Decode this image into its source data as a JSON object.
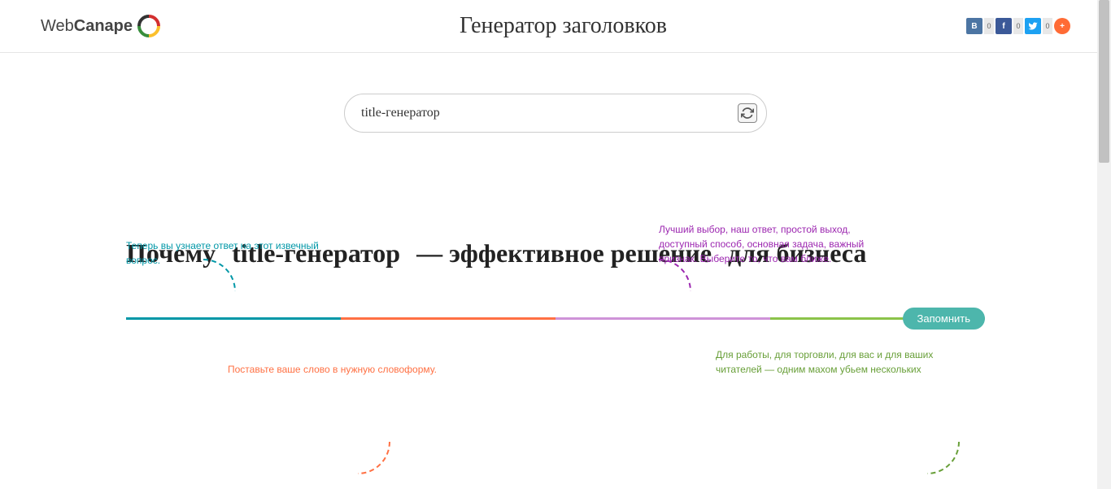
{
  "header": {
    "logo_web": "Web",
    "logo_canape": "Canape",
    "title": "Генератор заголовков"
  },
  "social": {
    "vk_count": "0",
    "fb_count": "0",
    "tw_count": "0"
  },
  "search": {
    "value": "title-генератор"
  },
  "hints": {
    "teal": "Теперь вы узнаете ответ на этот извечный вопрос.",
    "purple": "Лучший выбор, наш ответ, простой выход, доступный способ, основная задача, важный признак. Выберите то, что вам ближе.",
    "orange": "Поставьте ваше слово в нужную словоформу.",
    "green": "Для работы, для торговли, для вас и для ваших читателей — одним махом убьем нескольких"
  },
  "headline": {
    "part1": "Почему",
    "part2": "title-генератор",
    "part3": "— эффективное решение",
    "part4": "для бизнеса"
  },
  "buttons": {
    "remember": "Запомнить"
  }
}
